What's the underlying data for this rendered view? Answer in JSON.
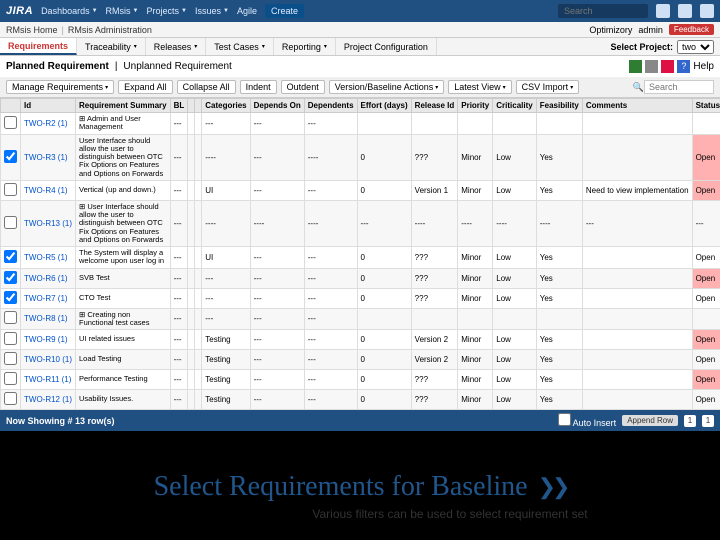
{
  "topbar": {
    "logo": "JIRA",
    "nav": [
      "Dashboards",
      "RMsis",
      "Projects",
      "Issues",
      "Agile"
    ],
    "create": "Create",
    "search_placeholder": "Search",
    "user": "admin"
  },
  "subbar": {
    "home": "RMsis Home",
    "admin": "RMsis Administration",
    "company": "Optimizory",
    "user": "admin",
    "feedback": "Feedback"
  },
  "tabs": {
    "items": [
      "Requirements",
      "Traceability",
      "Releases",
      "Test Cases",
      "Reporting",
      "Project Configuration"
    ],
    "select_project_label": "Select Project:",
    "project_value": "two"
  },
  "subtabs": {
    "planned": "Planned Requirement",
    "unplanned": "Unplanned Requirement",
    "help": "Help"
  },
  "toolbar": {
    "manage": "Manage Requirements",
    "expand": "Expand All",
    "collapse": "Collapse All",
    "indent": "Indent",
    "outdent": "Outdent",
    "version": "Version/Baseline Actions",
    "view": "Latest View",
    "csv": "CSV Import",
    "search_placeholder": "Search"
  },
  "columns": [
    "",
    "Id",
    "Requirement Summary",
    "BL",
    "",
    "",
    "Categories",
    "Depends On",
    "Dependents",
    "Effort (days)",
    "Release Id",
    "Priority",
    "Criticality",
    "Feasibility",
    "Comments",
    "Status"
  ],
  "rows": [
    {
      "cb": false,
      "id": "TWO-R2 (1)",
      "sum": "⊞ Admin and User Management",
      "bl": "---",
      "c1": "",
      "c2": "",
      "cat": "---",
      "dep": "---",
      "deps": "---",
      "eff": "",
      "rel": "",
      "pri": "",
      "crit": "",
      "feas": "",
      "com": "",
      "stat": ""
    },
    {
      "cb": true,
      "id": "TWO-R3 (1)",
      "sum": "User Interface should allow the user to distinguish between OTC Fix Options on Features and Options on Forwards",
      "bl": "---",
      "c1": "",
      "c2": "",
      "cat": "----",
      "dep": "---",
      "deps": "----",
      "eff": "0",
      "rel": "???",
      "pri": "Minor",
      "crit": "Low",
      "feas": "Yes",
      "com": "",
      "stat": "Open",
      "statcls": "stat-open"
    },
    {
      "cb": false,
      "id": "TWO-R4 (1)",
      "sum": "Vertical (up and down.)",
      "bl": "---",
      "c1": "",
      "c2": "",
      "cat": "UI",
      "dep": "---",
      "deps": "---",
      "eff": "0",
      "rel": "Version 1",
      "pri": "Minor",
      "crit": "Low",
      "feas": "Yes",
      "com": "Need to view implementation",
      "stat": "Open",
      "statcls": "stat-open"
    },
    {
      "cb": false,
      "id": "TWO-R13 (1)",
      "sum": "⊞ User Interface should allow the user to distinguish between OTC Fix Options on Features and Options on Forwards",
      "bl": "---",
      "c1": "",
      "c2": "",
      "cat": "----",
      "dep": "----",
      "deps": "----",
      "eff": "---",
      "rel": "----",
      "pri": "----",
      "crit": "----",
      "feas": "----",
      "com": "---",
      "stat": "---"
    },
    {
      "cb": true,
      "id": "TWO-R5 (1)",
      "sum": "The System will display a welcome upon user log in",
      "bl": "---",
      "c1": "",
      "c2": "",
      "cat": "UI",
      "dep": "---",
      "deps": "---",
      "eff": "0",
      "rel": "???",
      "pri": "Minor",
      "crit": "Low",
      "feas": "Yes",
      "com": "",
      "stat": "Open"
    },
    {
      "cb": true,
      "id": "TWO-R6 (1)",
      "sum": "SVB Test",
      "bl": "---",
      "c1": "",
      "c2": "",
      "cat": "---",
      "dep": "---",
      "deps": "---",
      "eff": "0",
      "rel": "???",
      "pri": "Minor",
      "crit": "Low",
      "feas": "Yes",
      "com": "",
      "stat": "Open",
      "statcls": "stat-open"
    },
    {
      "cb": true,
      "id": "TWO-R7 (1)",
      "sum": "CTO Test",
      "bl": "---",
      "c1": "",
      "c2": "",
      "cat": "---",
      "dep": "---",
      "deps": "---",
      "eff": "0",
      "rel": "???",
      "pri": "Minor",
      "crit": "Low",
      "feas": "Yes",
      "com": "",
      "stat": "Open"
    },
    {
      "cb": false,
      "id": "TWO-R8 (1)",
      "sum": "⊞ Creating non Functional test cases",
      "bl": "---",
      "c1": "",
      "c2": "",
      "cat": "---",
      "dep": "---",
      "deps": "---",
      "eff": "",
      "rel": "",
      "pri": "",
      "crit": "",
      "feas": "",
      "com": "",
      "stat": ""
    },
    {
      "cb": false,
      "id": "TWO-R9 (1)",
      "sum": "UI related issues",
      "bl": "---",
      "c1": "",
      "c2": "",
      "cat": "Testing",
      "dep": "---",
      "deps": "---",
      "eff": "0",
      "rel": "Version 2",
      "pri": "Minor",
      "crit": "Low",
      "feas": "Yes",
      "com": "",
      "stat": "Open",
      "statcls": "stat-open"
    },
    {
      "cb": false,
      "id": "TWO-R10 (1)",
      "sum": "Load Testing",
      "bl": "---",
      "c1": "",
      "c2": "",
      "cat": "Testing",
      "dep": "---",
      "deps": "---",
      "eff": "0",
      "rel": "Version 2",
      "pri": "Minor",
      "crit": "Low",
      "feas": "Yes",
      "com": "",
      "stat": "Open"
    },
    {
      "cb": false,
      "id": "TWO-R11 (1)",
      "sum": "Performance Testing",
      "bl": "---",
      "c1": "",
      "c2": "",
      "cat": "Testing",
      "dep": "---",
      "deps": "---",
      "eff": "0",
      "rel": "???",
      "pri": "Minor",
      "crit": "Low",
      "feas": "Yes",
      "com": "",
      "stat": "Open",
      "statcls": "stat-open"
    },
    {
      "cb": false,
      "id": "TWO-R12 (1)",
      "sum": "Usability Issues.",
      "bl": "---",
      "c1": "",
      "c2": "",
      "cat": "Testing",
      "dep": "---",
      "deps": "---",
      "eff": "0",
      "rel": "???",
      "pri": "Minor",
      "crit": "Low",
      "feas": "Yes",
      "com": "",
      "stat": "Open"
    }
  ],
  "footer": {
    "showing": "Now Showing # 13 row(s)",
    "auto": "Auto Insert",
    "append": "Append Row",
    "pages": [
      "1",
      "1"
    ]
  },
  "caption": {
    "title": "Select Requirements for Baseline",
    "sub": "Various filters can be used to select requirement set"
  }
}
